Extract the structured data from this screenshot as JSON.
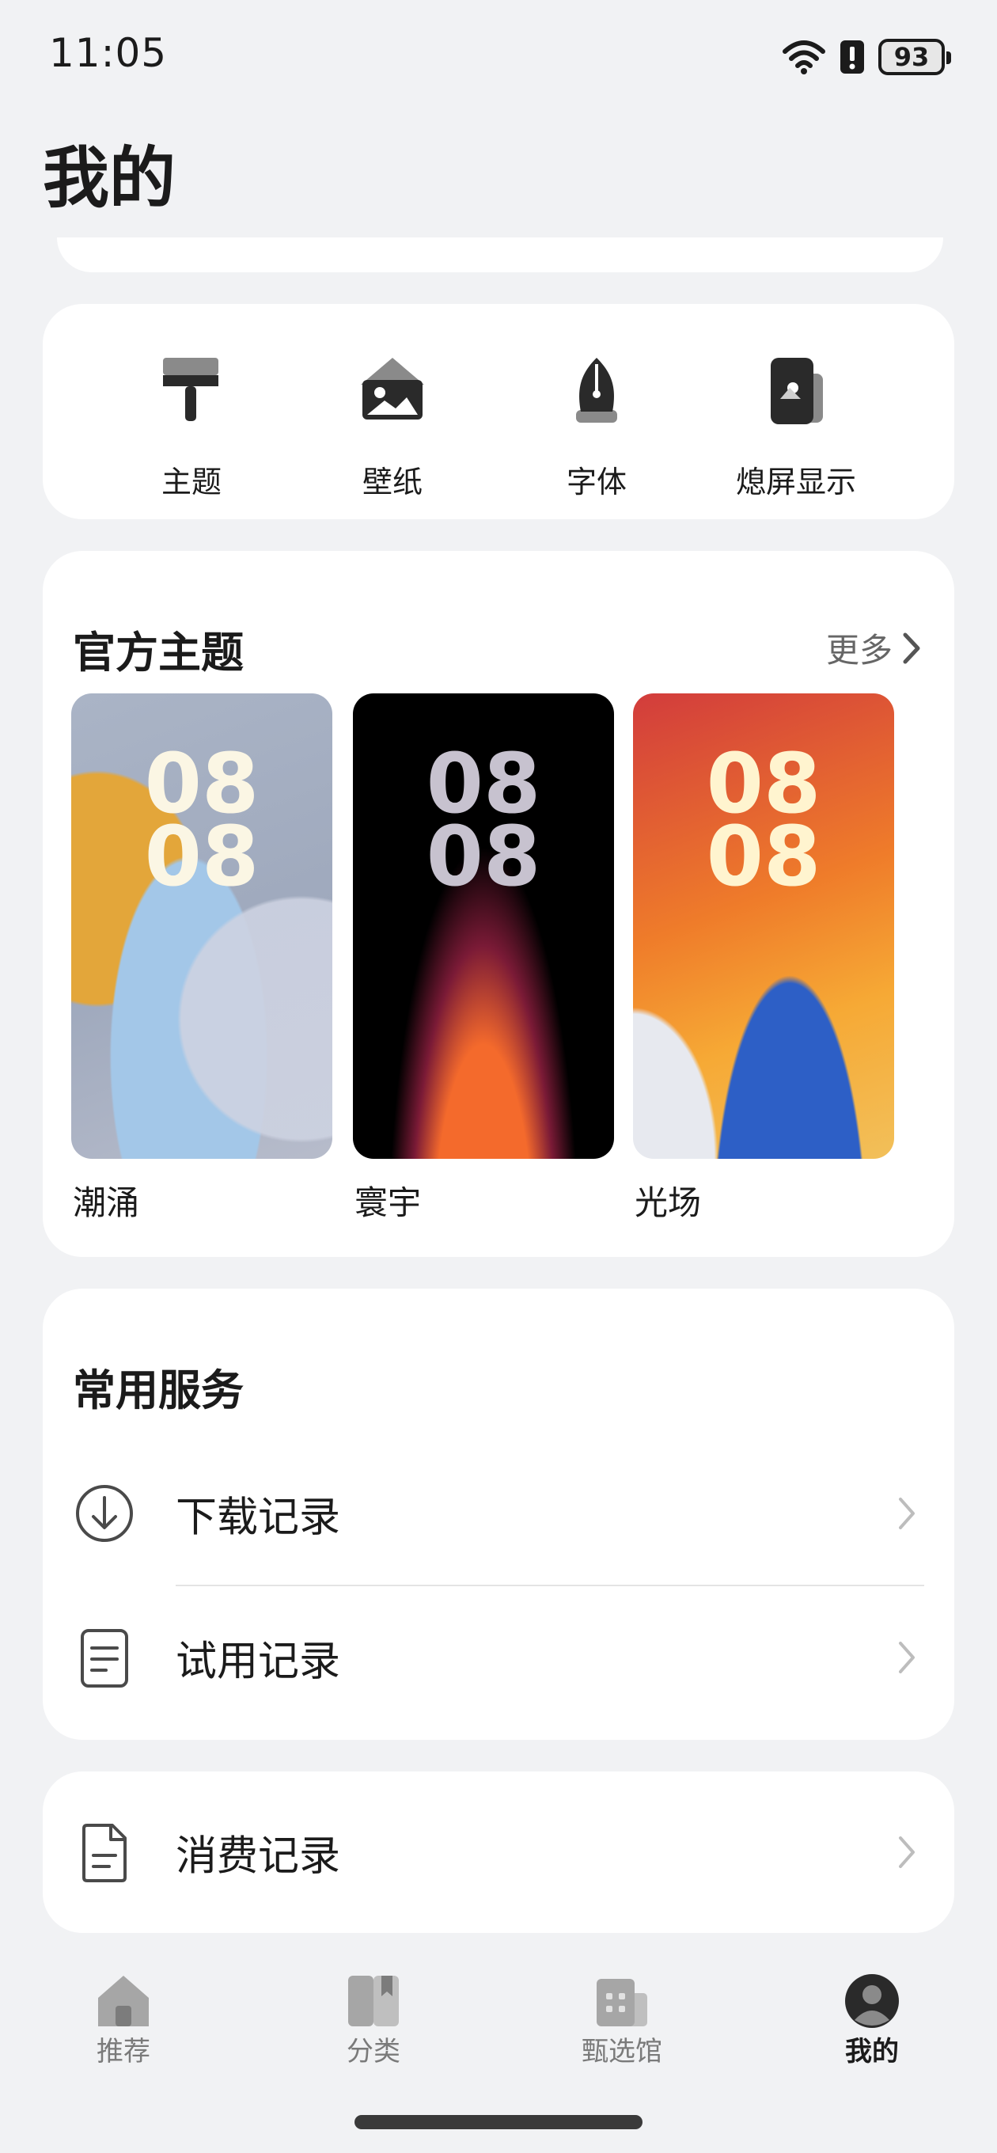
{
  "status_bar": {
    "time": "11:05",
    "battery": "93"
  },
  "page": {
    "title": "我的"
  },
  "tools": [
    {
      "label": "主题",
      "icon": "paint-brush-icon"
    },
    {
      "label": "壁纸",
      "icon": "wallpaper-icon"
    },
    {
      "label": "字体",
      "icon": "pen-nib-icon"
    },
    {
      "label": "熄屏显示",
      "icon": "always-on-display-icon"
    }
  ],
  "official_themes": {
    "title": "官方主题",
    "more": "更多",
    "items": [
      {
        "name": "潮涌",
        "clock_top": "08",
        "clock_bottom": "08"
      },
      {
        "name": "寰宇",
        "clock_top": "08",
        "clock_bottom": "08"
      },
      {
        "name": "光场",
        "clock_top": "08",
        "clock_bottom": "08"
      }
    ]
  },
  "services": {
    "title": "常用服务",
    "items": [
      {
        "label": "下载记录",
        "icon": "download-icon"
      },
      {
        "label": "试用记录",
        "icon": "document-icon"
      }
    ]
  },
  "purchase": {
    "label": "消费记录",
    "icon": "receipt-icon"
  },
  "bottom_nav": [
    {
      "label": "推荐",
      "icon": "home-icon",
      "active": false
    },
    {
      "label": "分类",
      "icon": "category-icon",
      "active": false
    },
    {
      "label": "甄选馆",
      "icon": "store-icon",
      "active": false
    },
    {
      "label": "我的",
      "icon": "profile-icon",
      "active": true
    }
  ],
  "colors": {
    "background": "#f1f2f4",
    "card": "#ffffff",
    "text": "#1b1b1b",
    "muted": "#7a7a7a"
  }
}
